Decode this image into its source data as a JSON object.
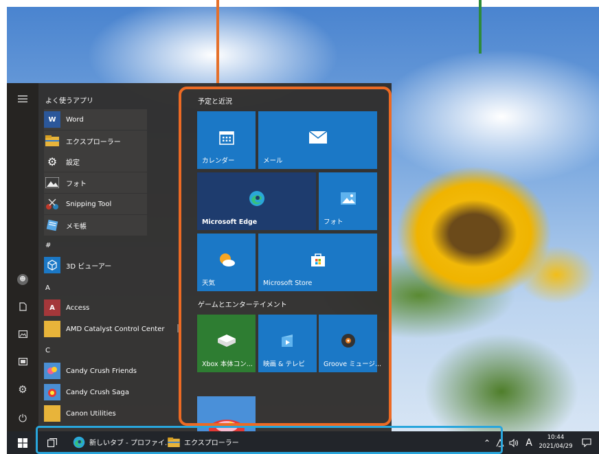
{
  "start_menu": {
    "frequent_heading": "よく使うアプリ",
    "pinned_apps": [
      {
        "label": "Word",
        "icon": "word-icon"
      },
      {
        "label": "エクスプローラー",
        "icon": "folder-icon"
      },
      {
        "label": "設定",
        "icon": "gear-icon"
      },
      {
        "label": "フォト",
        "icon": "photos-icon"
      },
      {
        "label": "Snipping Tool",
        "icon": "snipping-tool-icon"
      },
      {
        "label": "メモ帳",
        "icon": "notepad-icon"
      }
    ],
    "sections": [
      {
        "letter": "#",
        "apps": [
          {
            "label": "3D ビューアー",
            "icon": "3d-viewer-icon"
          }
        ]
      },
      {
        "letter": "A",
        "apps": [
          {
            "label": "Access",
            "icon": "access-icon"
          },
          {
            "label": "AMD Catalyst Control Center",
            "icon": "folder-icon"
          }
        ]
      },
      {
        "letter": "C",
        "apps": [
          {
            "label": "Candy Crush Friends",
            "icon": "candy-crush-friends-icon"
          },
          {
            "label": "Candy Crush Saga",
            "icon": "candy-crush-saga-icon"
          },
          {
            "label": "Canon Utilities",
            "icon": "folder-icon"
          }
        ]
      }
    ],
    "tile_groups": [
      {
        "title": "予定と近況"
      },
      {
        "title": "ゲームとエンターテイメント"
      }
    ],
    "tiles": {
      "calendar": "カレンダー",
      "mail": "メール",
      "edge": "Microsoft Edge",
      "photos": "フォト",
      "weather": "天気",
      "store": "Microsoft Store",
      "xbox": "Xbox 本体コン...",
      "movies": "映画 & テレビ",
      "groove": "Groove ミュージ..."
    }
  },
  "taskbar": {
    "apps": [
      {
        "label": "新しいタブ - プロファイ...",
        "icon": "edge-icon"
      },
      {
        "label": "エクスプローラー",
        "icon": "folder-icon"
      }
    ],
    "ime_indicator": "A",
    "time": "10:44",
    "date": "2021/04/29"
  },
  "colors": {
    "tile_blue": "#1b78c6",
    "tile_dark": "#1e3c6e",
    "tile_green": "#2e7d32",
    "orange_annotation": "#ec6a24",
    "blue_annotation": "#29a6dc"
  }
}
